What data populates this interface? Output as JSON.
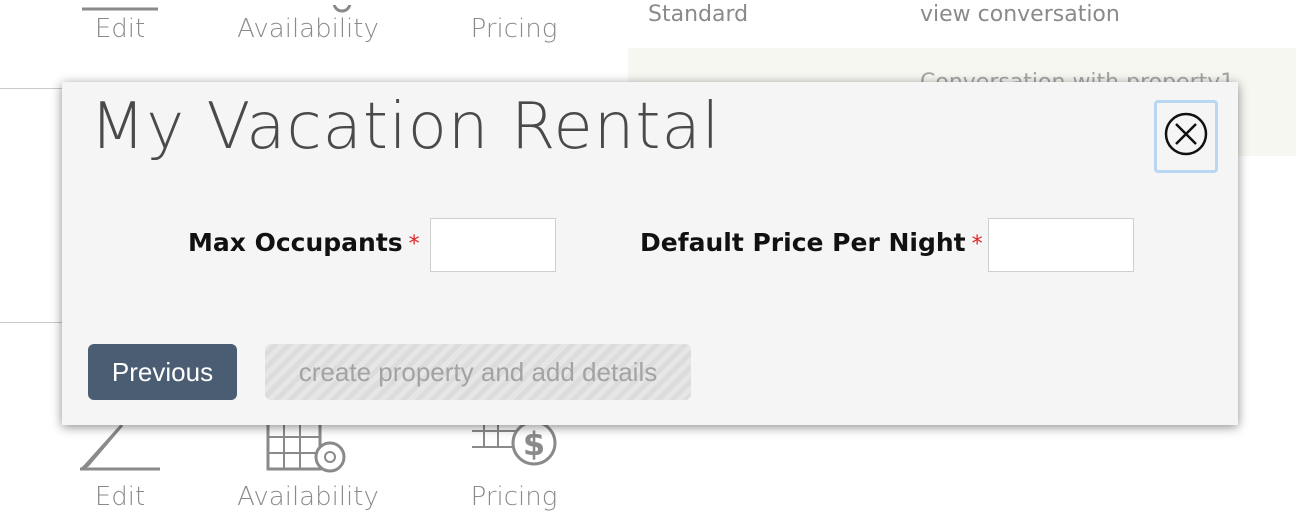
{
  "background": {
    "top_actions": [
      {
        "label": "Edit",
        "icon": "pencil-icon"
      },
      {
        "label": "Availability",
        "icon": "calendar-gear-icon"
      },
      {
        "label": "Pricing",
        "icon": "calendar-dollar-icon"
      }
    ],
    "bottom_actions": [
      {
        "label": "Edit",
        "icon": "pencil-icon"
      },
      {
        "label": "Availability",
        "icon": "calendar-gear-icon"
      },
      {
        "label": "Pricing",
        "icon": "calendar-dollar-icon"
      }
    ],
    "plan_label": "Standard",
    "view_conversation_link": "view conversation",
    "conversation_preview": "Conversation with property1"
  },
  "modal": {
    "title": "My Vacation Rental",
    "close_icon": "close-circle-icon",
    "fields": [
      {
        "label": "Max Occupants",
        "required_mark": "*",
        "value": ""
      },
      {
        "label": "Default Price Per Night",
        "required_mark": "*",
        "value": ""
      }
    ],
    "previous_button": "Previous",
    "submit_button": "create property and add details"
  },
  "colors": {
    "primary_button": "#4b5d72",
    "required": "#e02020",
    "focus_ring": "#b9d6f3"
  }
}
